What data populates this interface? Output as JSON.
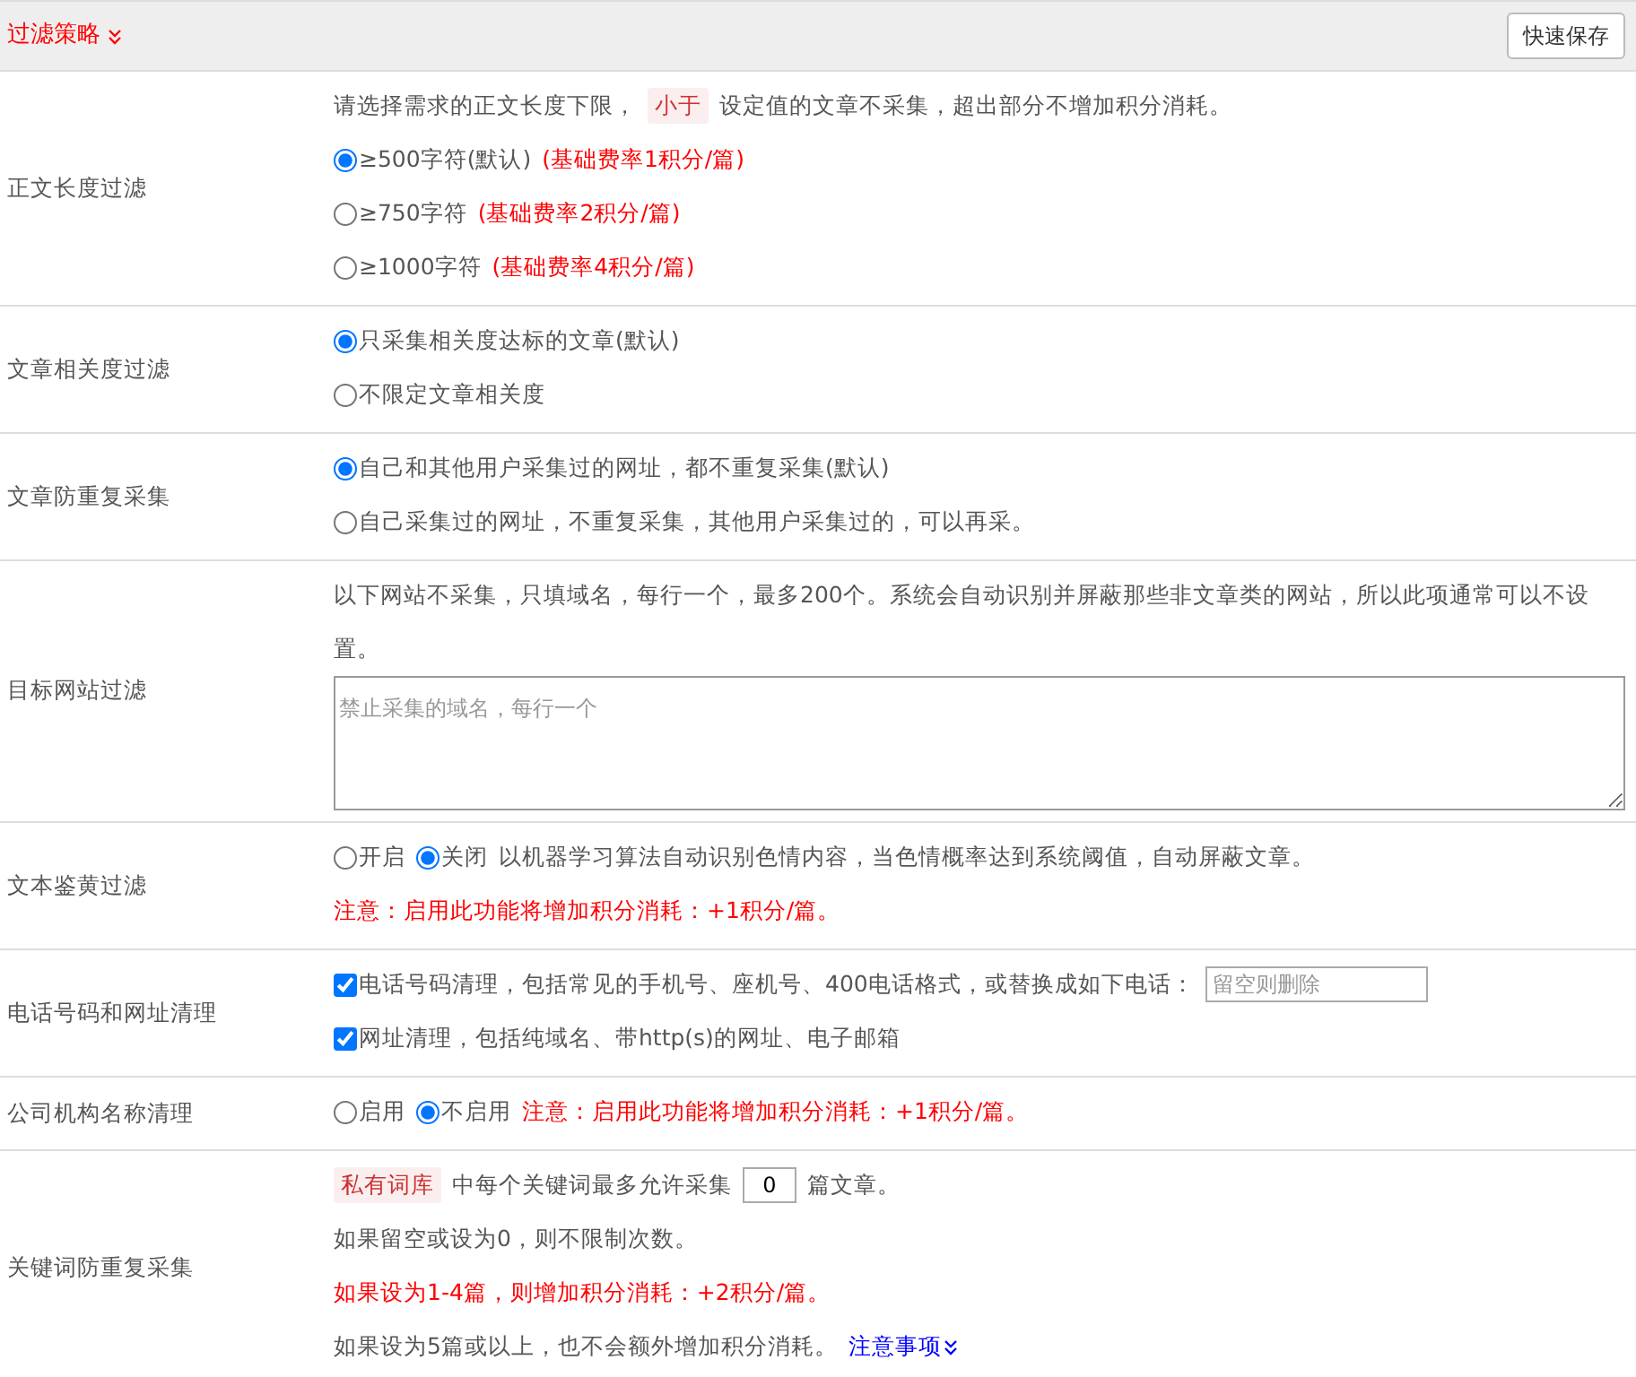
{
  "header": {
    "title": "过滤策略",
    "button": "快速保存"
  },
  "rows": [
    {
      "label": "正文长度过滤",
      "lines": [
        [
          {
            "kind": "text",
            "text": "请选择需求的正文长度下限，"
          },
          {
            "kind": "tag",
            "text": "小于"
          },
          {
            "kind": "text",
            "text": "设定值的文章不采集，超出部分不增加积分消耗。"
          }
        ],
        [
          {
            "kind": "radio",
            "text": "≥500字符(默认)",
            "selected": true
          },
          {
            "kind": "note",
            "text": "(基础费率1积分/篇)"
          }
        ],
        [
          {
            "kind": "radio",
            "text": "≥750字符",
            "selected": false
          },
          {
            "kind": "note",
            "text": "(基础费率2积分/篇)"
          }
        ],
        [
          {
            "kind": "radio",
            "text": "≥1000字符",
            "selected": false
          },
          {
            "kind": "note",
            "text": "(基础费率4积分/篇)"
          }
        ]
      ]
    },
    {
      "label": "文章相关度过滤",
      "lines": [
        [
          {
            "kind": "radio",
            "text": "只采集相关度达标的文章(默认)",
            "selected": true
          }
        ],
        [
          {
            "kind": "radio",
            "text": "不限定文章相关度",
            "selected": false
          }
        ]
      ]
    },
    {
      "label": "文章防重复采集",
      "lines": [
        [
          {
            "kind": "radio",
            "text": "自己和其他用户采集过的网址，都不重复采集(默认)",
            "selected": true
          }
        ],
        [
          {
            "kind": "radio",
            "text": "自己采集过的网址，不重复采集，其他用户采集过的，可以再采。",
            "selected": false
          }
        ]
      ]
    },
    {
      "label": "目标网站过滤",
      "lines": [
        [
          {
            "kind": "text",
            "text": "以下网站不采集，只填域名，每行一个，最多200个。系统会自动识别并屏蔽那些非文章类的网站，所以此项通常可以不设置。"
          }
        ],
        [
          {
            "kind": "textarea",
            "placeholder": "禁止采集的域名，每行一个"
          }
        ]
      ]
    },
    {
      "label": "文本鉴黄过滤",
      "lines": [
        [
          {
            "kind": "radio",
            "text": "开启",
            "selected": false
          },
          {
            "kind": "radio",
            "text": "关闭",
            "selected": true
          },
          {
            "kind": "text",
            "text": "以机器学习算法自动识别色情内容，当色情概率达到系统阈值，自动屏蔽文章。"
          }
        ],
        [
          {
            "kind": "note",
            "text": "注意：启用此功能将增加积分消耗：+1积分/篇。"
          }
        ]
      ]
    },
    {
      "label": "电话号码和网址清理",
      "lines": [
        [
          {
            "kind": "checkbox",
            "text": "电话号码清理，包括常见的手机号、座机号、400电话格式，或替换成如下电话：",
            "checked": true
          },
          {
            "kind": "input",
            "placeholder": "留空则删除"
          }
        ],
        [
          {
            "kind": "checkbox",
            "text": "网址清理，包括纯域名、带http(s)的网址、电子邮箱",
            "checked": true
          }
        ]
      ]
    },
    {
      "label": "公司机构名称清理",
      "lines": [
        [
          {
            "kind": "radio",
            "text": "启用",
            "selected": false
          },
          {
            "kind": "radio",
            "text": "不启用",
            "selected": true
          },
          {
            "kind": "note",
            "text": "注意：启用此功能将增加积分消耗：+1积分/篇。"
          }
        ]
      ]
    },
    {
      "label": "关键词防重复采集",
      "lines": [
        [
          {
            "kind": "tag",
            "text": "私有词库"
          },
          {
            "kind": "text",
            "text": "中每个关键词最多允许采集"
          },
          {
            "kind": "number",
            "value": "0"
          },
          {
            "kind": "text",
            "text": "篇文章。"
          }
        ],
        [
          {
            "kind": "text",
            "text": "如果留空或设为0，则不限制次数。"
          }
        ],
        [
          {
            "kind": "note",
            "text": "如果设为1-4篇，则增加积分消耗：+2积分/篇。"
          }
        ],
        [
          {
            "kind": "text",
            "text": "如果设为5篇或以上，也不会额外增加积分消耗。"
          },
          {
            "kind": "link",
            "text": "注意事项"
          }
        ]
      ]
    }
  ]
}
